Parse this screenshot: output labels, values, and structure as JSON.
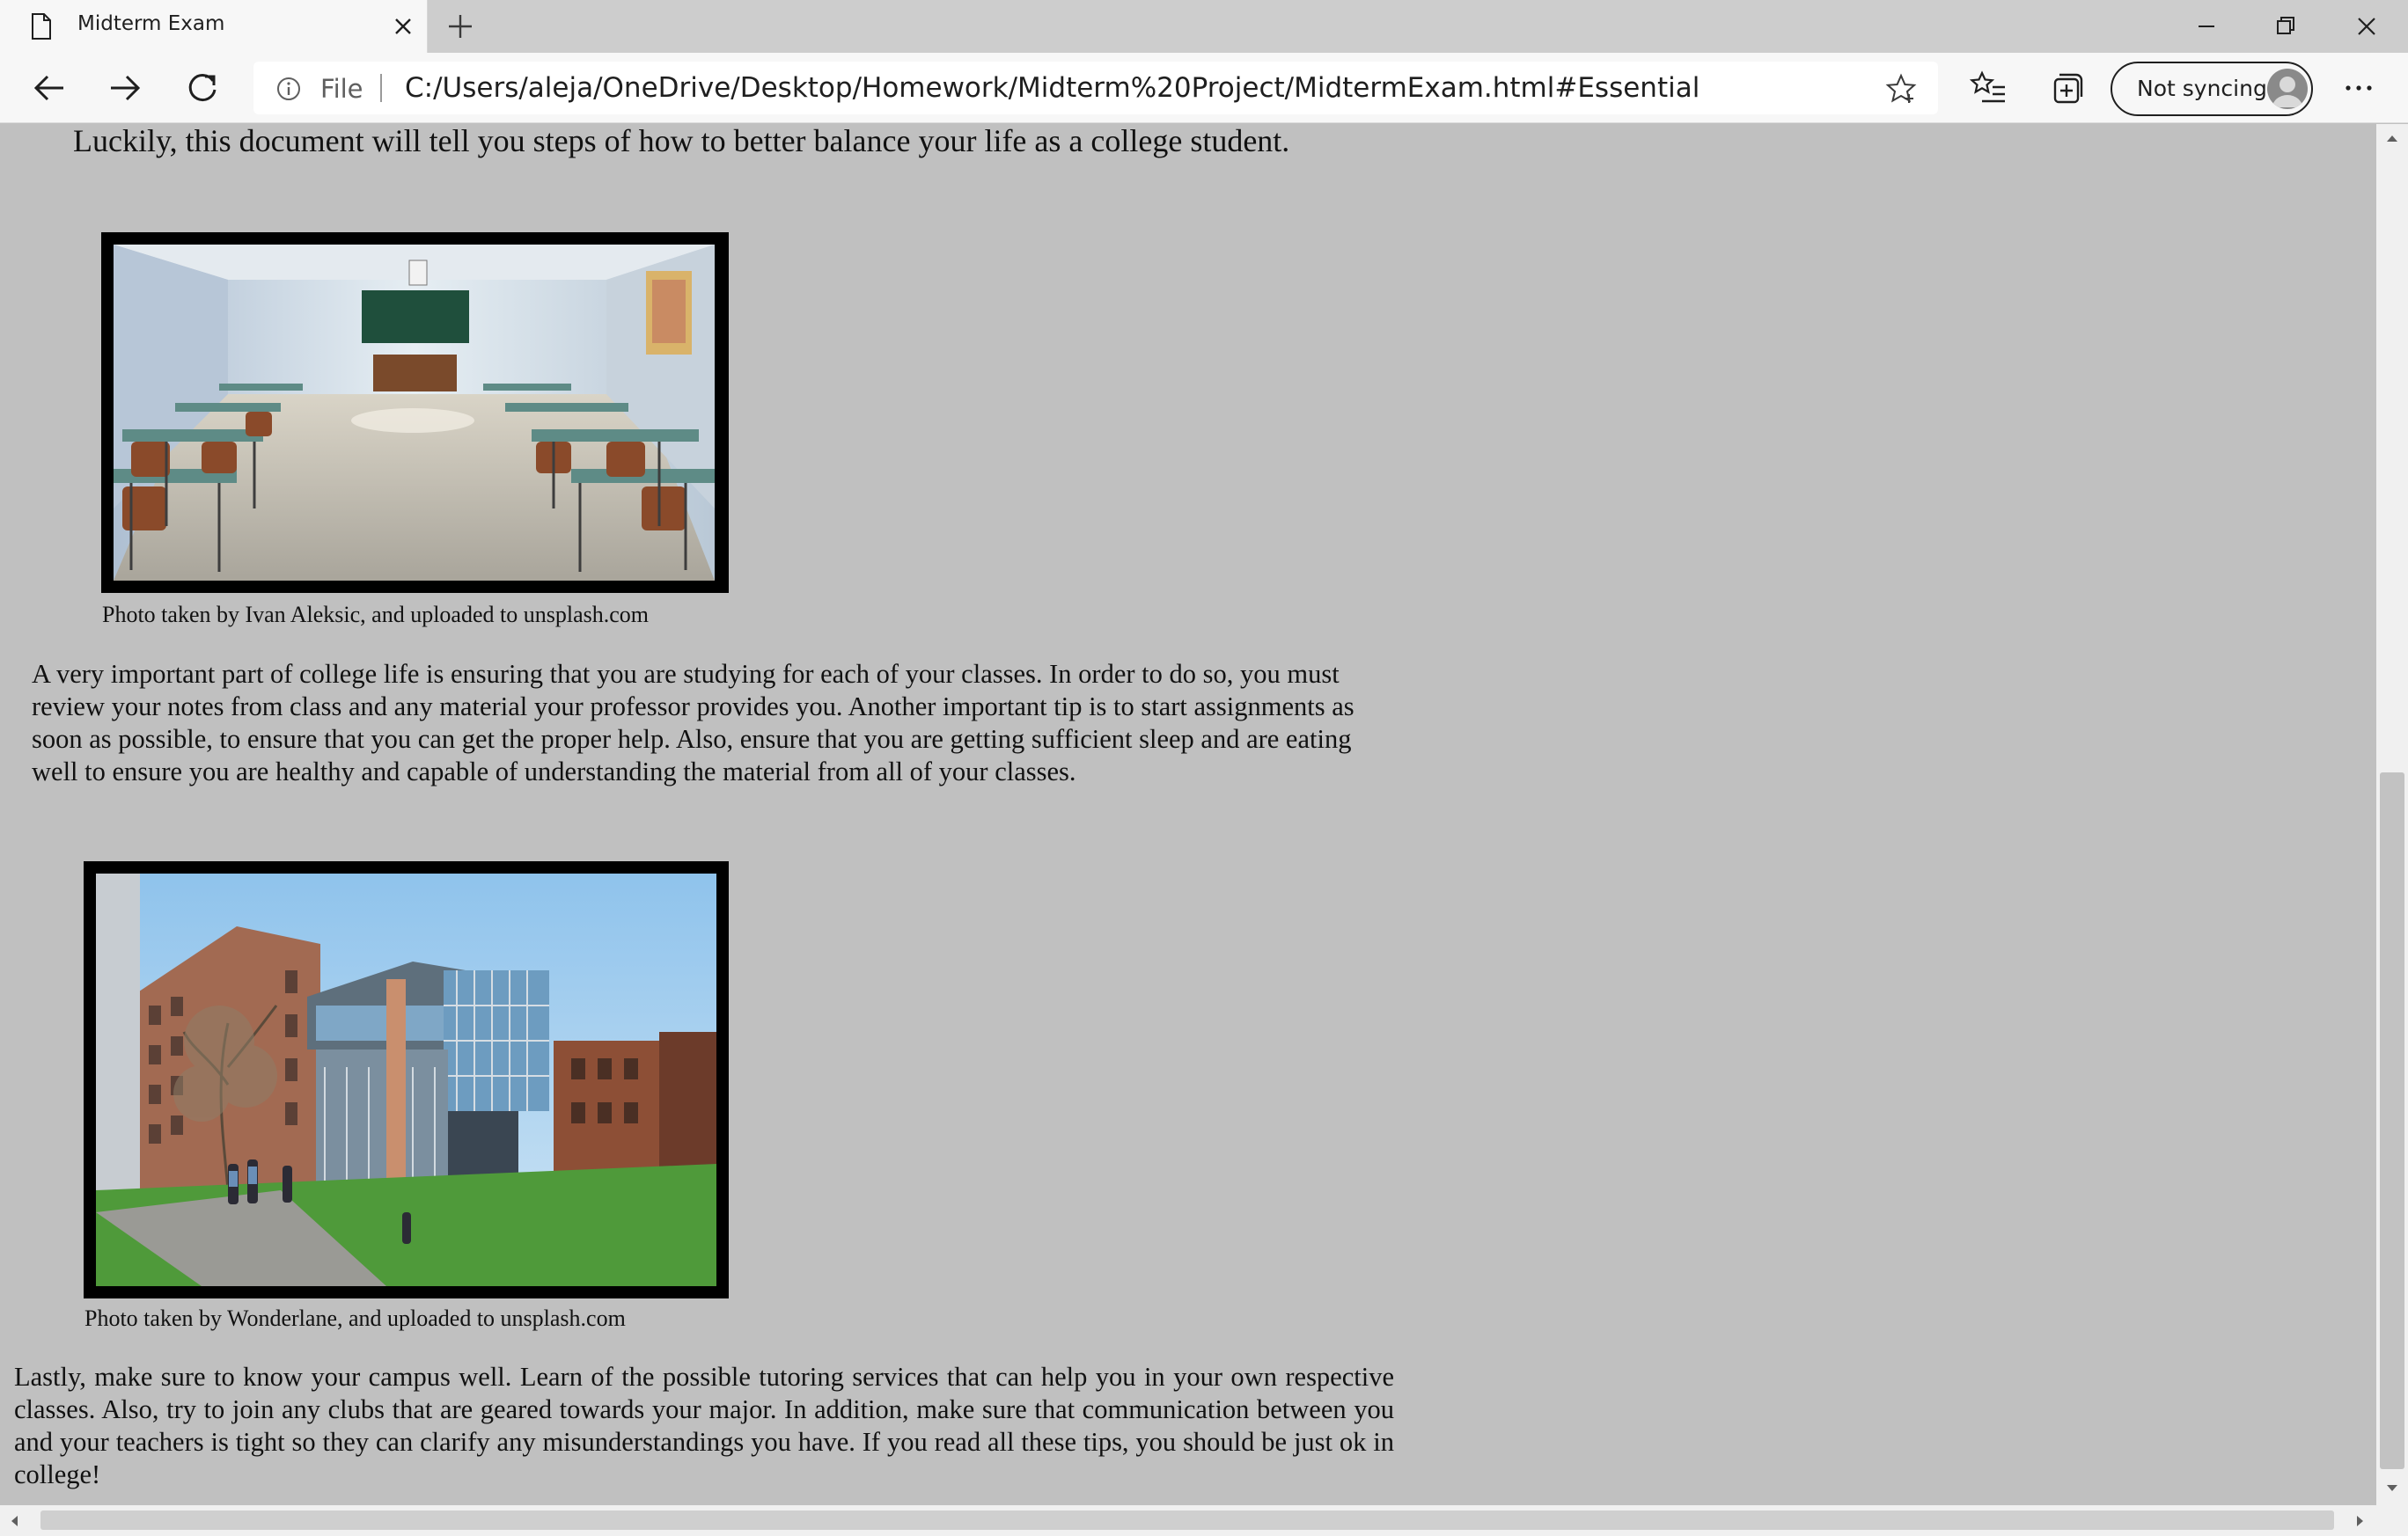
{
  "browser": {
    "tab_title": "Midterm Exam",
    "address": {
      "scheme_label": "File",
      "url": "C:/Users/aleja/OneDrive/Desktop/Homework/Midterm%20Project/MidtermExam.html#Essential"
    },
    "profile_button_label": "Not syncing"
  },
  "page": {
    "intro_line": "Luckily, this document will tell you steps of how to better balance your life as a college student.",
    "photos": [
      {
        "subject": "classroom with desks and chalkboard",
        "caption": "Photo taken by Ivan Aleksic, and uploaded to unsplash.com"
      },
      {
        "subject": "modern campus building with students on lawn",
        "caption": "Photo taken by Wonderlane, and uploaded to unsplash.com"
      }
    ],
    "paragraph_1": "A very important part of college life is ensuring that you are studying for each of your classes. In order to do so, you must review your notes from class and any material your professor provides you. Another important tip is to start assignments as soon as possible, to ensure that you can get the proper help. Also, ensure that you are getting sufficient sleep and are eating well to ensure you are healthy and capable of understanding the material from all of your classes.",
    "paragraph_2": "Lastly, make sure to know your campus well. Learn of the possible tutoring services that can help you in your own respective classes. Also, try to join any clubs that are geared towards your major. In addition, make sure that communication between you and your teachers is tight so they can clarify any misunderstandings you have. If you read all these tips, you should be just ok in college!"
  },
  "colors": {
    "page_background": "#c0c0c0",
    "chrome_background": "#f7f7f7",
    "tabstrip_background": "#cdcdcd"
  },
  "icons": [
    "page-icon",
    "close-icon",
    "plus-icon",
    "minimize-icon",
    "restore-icon",
    "window-close-icon",
    "back-arrow-icon",
    "forward-arrow-icon",
    "reload-icon",
    "info-icon",
    "star-add-icon",
    "favorites-icon",
    "collections-icon",
    "user-avatar-icon",
    "more-icon"
  ]
}
